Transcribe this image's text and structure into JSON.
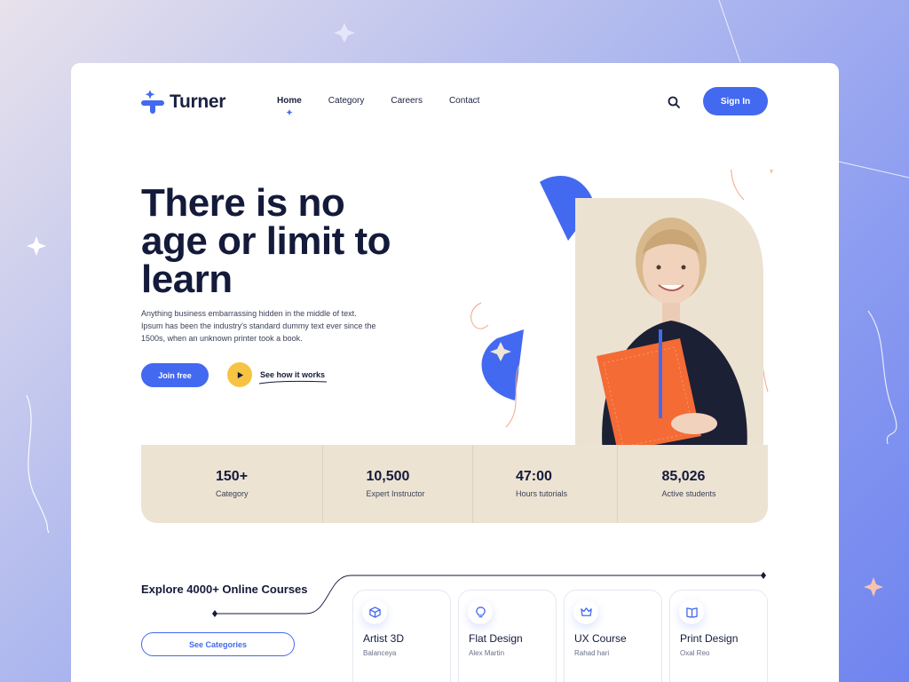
{
  "brand": {
    "name": "Turner",
    "accent": "#4269f0",
    "dark": "#141a3a",
    "yellow": "#f6c343",
    "beige": "#ede3d3"
  },
  "nav": {
    "items": [
      {
        "label": "Home",
        "active": true
      },
      {
        "label": "Category",
        "active": false
      },
      {
        "label": "Careers",
        "active": false
      },
      {
        "label": "Contact",
        "active": false
      }
    ],
    "search_icon": "search-icon",
    "signin_label": "Sign In"
  },
  "hero": {
    "title": "There is no age or limit to learn",
    "description": "Anything business embarrassing hidden in the middle of text. Ipsum has been the industry's standard dummy text ever since the 1500s, when an unknown printer took a book.",
    "join_label": "Join free",
    "how_label": "See how it works",
    "play_icon": "play-icon"
  },
  "stats": [
    {
      "value": "150+",
      "label": "Category"
    },
    {
      "value": "10,500",
      "label": "Expert Instructor"
    },
    {
      "value": "47:00",
      "label": "Hours tutorials"
    },
    {
      "value": "85,026",
      "label": "Active students"
    }
  ],
  "explore": {
    "prefix": "Explore ",
    "highlight": "4000+",
    "suffix": " Online Courses",
    "see_categories_label": "See Categories"
  },
  "courses": [
    {
      "title": "Artist 3D",
      "author": "Balanceya",
      "icon": "cube-icon"
    },
    {
      "title": "Flat Design",
      "author": "Alex Martin",
      "icon": "lightbulb-icon"
    },
    {
      "title": "UX Course",
      "author": "Rahad hari",
      "icon": "crown-icon"
    },
    {
      "title": "Print Design",
      "author": "Oxal Reo",
      "icon": "book-icon"
    }
  ]
}
